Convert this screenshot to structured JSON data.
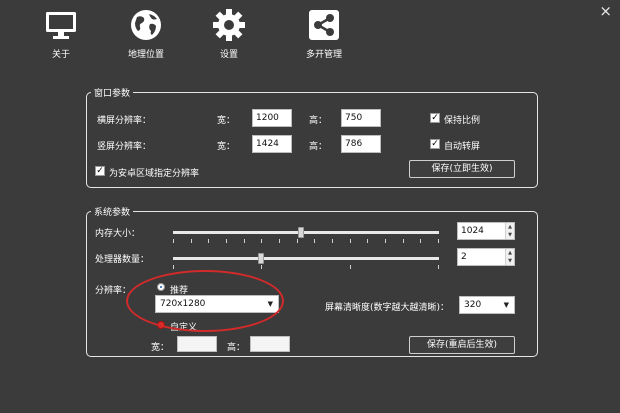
{
  "toolbar": {
    "items": [
      {
        "label": "关于",
        "icon": "monitor-icon"
      },
      {
        "label": "地理位置",
        "icon": "globe-icon"
      },
      {
        "label": "设置",
        "icon": "gear-icon"
      },
      {
        "label": "多开管理",
        "icon": "share-icon"
      }
    ],
    "close": "×"
  },
  "window_params": {
    "title": "窗口参数",
    "landscape_label": "横屏分辨率：",
    "portrait_label": "竖屏分辨率：",
    "width_label": "宽：",
    "height_label": "高：",
    "landscape_width": "1200",
    "landscape_height": "750",
    "portrait_width": "1424",
    "portrait_height": "786",
    "keep_ratio": "保持比例",
    "auto_rotate": "自动转屏",
    "android_area": "为安卓区域指定分辨率",
    "save_button": "保存(立即生效)",
    "check_mark": "✓"
  },
  "system_params": {
    "title": "系统参数",
    "memory_label": "内存大小：",
    "memory_value": "1024",
    "cpu_label": "处理器数量：",
    "cpu_value": "2",
    "resolution_label": "分辨率：",
    "recommend_label": "推荐",
    "resolution_value": "720x1280",
    "custom_label": "自定义",
    "width_label": "宽：",
    "height_label": "高：",
    "dpi_label": "屏幕清晰度(数字越大越清晰)：",
    "dpi_value": "320",
    "save_button": "保存(重启后生效)",
    "memory_level": 0.48,
    "cpu_level": 0.33
  },
  "colors": {
    "background": "#3b3b3b",
    "annotation": "#d32a2a"
  }
}
